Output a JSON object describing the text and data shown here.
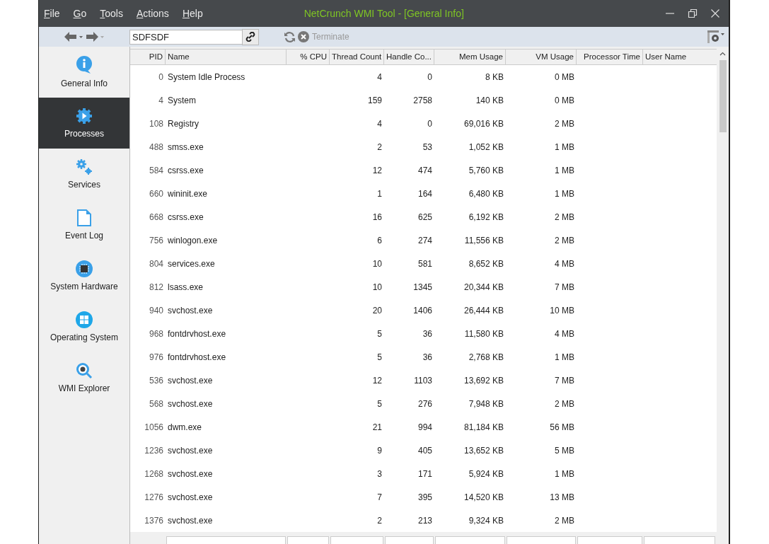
{
  "menu": [
    "File",
    "Go",
    "Tools",
    "Actions",
    "Help"
  ],
  "window": {
    "title": "NetCrunch WMI Tool - [General Info]"
  },
  "toolbar": {
    "host": "SDFSDF",
    "terminate": "Terminate"
  },
  "sidebar": {
    "items": [
      {
        "label": "General Info",
        "kind": "info",
        "selected": false
      },
      {
        "label": "Processes",
        "kind": "process",
        "selected": true
      },
      {
        "label": "Services",
        "kind": "services",
        "selected": false
      },
      {
        "label": "Event Log",
        "kind": "log",
        "selected": false
      },
      {
        "label": "System Hardware",
        "kind": "chip",
        "selected": false
      },
      {
        "label": "Operating System",
        "kind": "windows",
        "selected": false
      },
      {
        "label": "WMI Explorer",
        "kind": "explorer",
        "selected": false
      }
    ]
  },
  "table": {
    "columns": [
      "PID",
      "Name",
      "% CPU",
      "Thread Count",
      "Handle Co...",
      "Mem Usage",
      "VM Usage",
      "Processor Time",
      "User Name"
    ],
    "rows": [
      {
        "pid": "0",
        "name": "System Idle Process",
        "threads": "4",
        "handles": "0",
        "mem": "8 KB",
        "vm": "0 MB"
      },
      {
        "pid": "4",
        "name": "System",
        "threads": "159",
        "handles": "2758",
        "mem": "140 KB",
        "vm": "0 MB"
      },
      {
        "pid": "108",
        "name": "Registry",
        "threads": "4",
        "handles": "0",
        "mem": "69,016 KB",
        "vm": "2 MB"
      },
      {
        "pid": "488",
        "name": "smss.exe",
        "threads": "2",
        "handles": "53",
        "mem": "1,052 KB",
        "vm": "1 MB"
      },
      {
        "pid": "584",
        "name": "csrss.exe",
        "threads": "12",
        "handles": "474",
        "mem": "5,760 KB",
        "vm": "1 MB"
      },
      {
        "pid": "660",
        "name": "wininit.exe",
        "threads": "1",
        "handles": "164",
        "mem": "6,480 KB",
        "vm": "1 MB"
      },
      {
        "pid": "668",
        "name": "csrss.exe",
        "threads": "16",
        "handles": "625",
        "mem": "6,192 KB",
        "vm": "2 MB"
      },
      {
        "pid": "756",
        "name": "winlogon.exe",
        "threads": "6",
        "handles": "274",
        "mem": "11,556 KB",
        "vm": "2 MB"
      },
      {
        "pid": "804",
        "name": "services.exe",
        "threads": "10",
        "handles": "581",
        "mem": "8,652 KB",
        "vm": "4 MB"
      },
      {
        "pid": "812",
        "name": "lsass.exe",
        "threads": "10",
        "handles": "1345",
        "mem": "20,344 KB",
        "vm": "7 MB"
      },
      {
        "pid": "940",
        "name": "svchost.exe",
        "threads": "20",
        "handles": "1406",
        "mem": "26,444 KB",
        "vm": "10 MB"
      },
      {
        "pid": "968",
        "name": "fontdrvhost.exe",
        "threads": "5",
        "handles": "36",
        "mem": "11,580 KB",
        "vm": "4 MB"
      },
      {
        "pid": "976",
        "name": "fontdrvhost.exe",
        "threads": "5",
        "handles": "36",
        "mem": "2,768 KB",
        "vm": "1 MB"
      },
      {
        "pid": "536",
        "name": "svchost.exe",
        "threads": "12",
        "handles": "1103",
        "mem": "13,692 KB",
        "vm": "7 MB"
      },
      {
        "pid": "568",
        "name": "svchost.exe",
        "threads": "5",
        "handles": "276",
        "mem": "7,948 KB",
        "vm": "2 MB"
      },
      {
        "pid": "1056",
        "name": "dwm.exe",
        "threads": "21",
        "handles": "994",
        "mem": "81,184 KB",
        "vm": "56 MB"
      },
      {
        "pid": "1236",
        "name": "svchost.exe",
        "threads": "9",
        "handles": "405",
        "mem": "13,652 KB",
        "vm": "5 MB"
      },
      {
        "pid": "1268",
        "name": "svchost.exe",
        "threads": "3",
        "handles": "171",
        "mem": "5,924 KB",
        "vm": "1 MB"
      },
      {
        "pid": "1276",
        "name": "svchost.exe",
        "threads": "7",
        "handles": "395",
        "mem": "14,520 KB",
        "vm": "13 MB"
      },
      {
        "pid": "1376",
        "name": "svchost.exe",
        "threads": "2",
        "handles": "213",
        "mem": "9,324 KB",
        "vm": "2 MB"
      }
    ]
  }
}
